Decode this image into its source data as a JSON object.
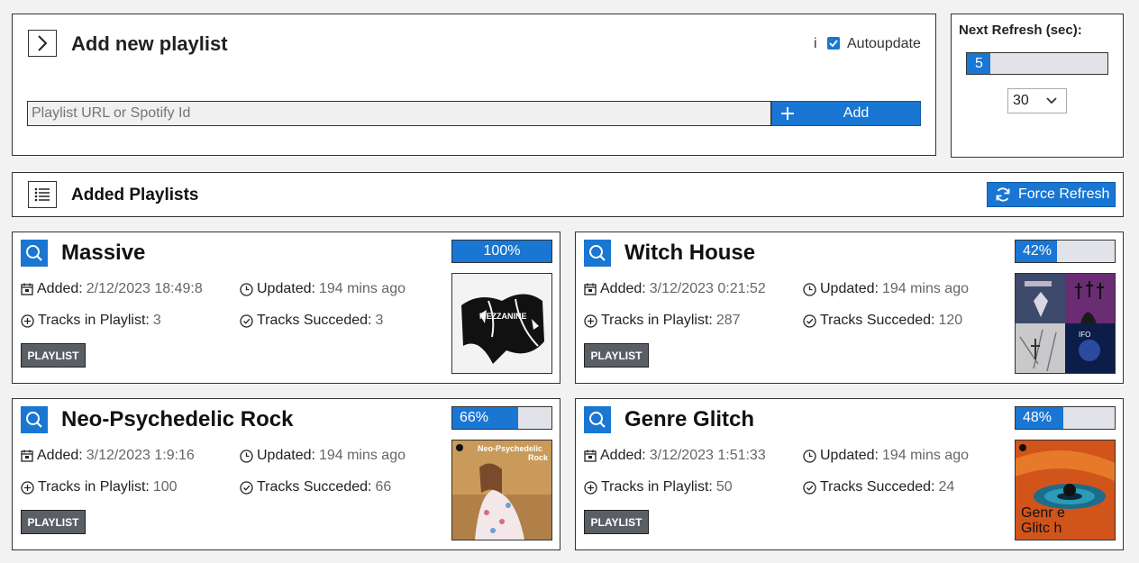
{
  "add_panel": {
    "title": "Add new playlist",
    "info_label": "i",
    "autoupdate_label": "Autoupdate",
    "autoupdate_checked": true,
    "input_placeholder": "Playlist URL or Spotify Id",
    "input_value": "",
    "add_label": "Add"
  },
  "refresh_panel": {
    "title": "Next Refresh (sec):",
    "countdown": "5",
    "countdown_fraction": 0.167,
    "interval_value": "30"
  },
  "added_header": {
    "title": "Added Playlists",
    "force_refresh_label": "Force Refresh"
  },
  "labels": {
    "added": "Added:",
    "updated": "Updated:",
    "tracks_in_playlist": "Tracks in Playlist:",
    "tracks_succeeded": "Tracks Succeded:",
    "tag": "PLAYLIST"
  },
  "playlists": [
    {
      "name": "Massive",
      "progress_label": "100%",
      "progress": 1.0,
      "added": "2/12/2023 18:49:8",
      "updated": "194 mins ago",
      "tracks": "3",
      "succeeded": "3",
      "cover_text": "MEZZANINE"
    },
    {
      "name": "Witch House",
      "progress_label": "42%",
      "progress": 0.42,
      "added": "3/12/2023 0:21:52",
      "updated": "194 mins ago",
      "tracks": "287",
      "succeeded": "120",
      "cover_text": ""
    },
    {
      "name": "Neo-Psychedelic Rock",
      "progress_label": "66%",
      "progress": 0.66,
      "added": "3/12/2023 1:9:16",
      "updated": "194 mins ago",
      "tracks": "100",
      "succeeded": "66",
      "cover_text": "Neo-Psychedelic Rock"
    },
    {
      "name": "Genre Glitch",
      "progress_label": "48%",
      "progress": 0.48,
      "added": "3/12/2023 1:51:33",
      "updated": "194 mins ago",
      "tracks": "50",
      "succeeded": "24",
      "cover_text": "Genr e Glitc h"
    }
  ]
}
